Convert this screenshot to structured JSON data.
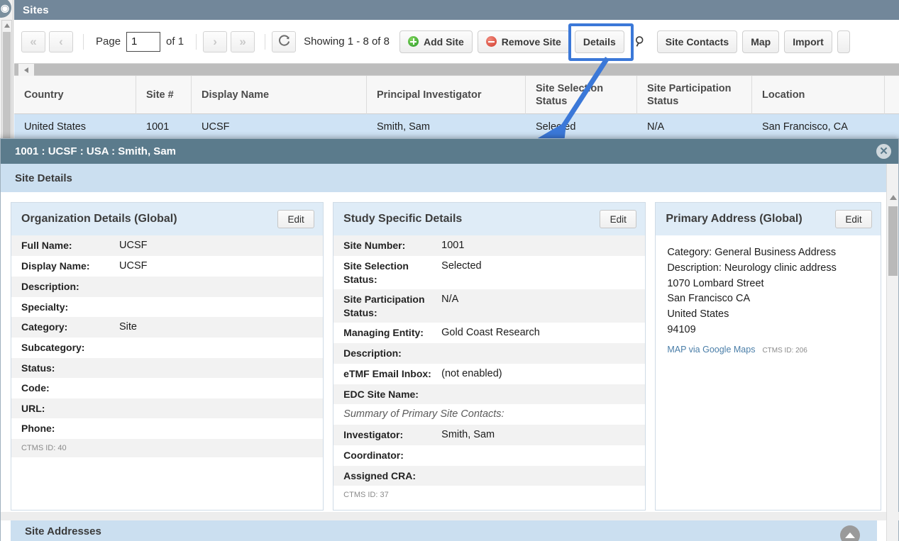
{
  "window": {
    "section_title": "Sites"
  },
  "toolbar": {
    "first_page_icon": "double-chevron-left-icon",
    "prev_page_icon": "chevron-left-icon",
    "page_label": "Page",
    "page_value": "1",
    "of_label": "of 1",
    "next_page_icon": "chevron-right-icon",
    "last_page_icon": "double-chevron-right-icon",
    "refresh_icon": "refresh-icon",
    "showing_text": "Showing 1 - 8 of 8",
    "add_site": "Add Site",
    "remove_site": "Remove Site",
    "details": "Details",
    "search_icon": "magnifier-icon",
    "site_contacts": "Site Contacts",
    "map": "Map",
    "import": "Import"
  },
  "grid": {
    "columns": [
      "Country",
      "Site #",
      "Display Name",
      "Principal Investigator",
      "Site Selection Status",
      "Site Participation Status",
      "Location"
    ],
    "rows": [
      [
        "United States",
        "1001",
        "UCSF",
        "Smith, Sam",
        "Selected",
        "N/A",
        "San Francisco, CA"
      ]
    ]
  },
  "dialog": {
    "title": "1001 : UCSF : USA : Smith, Sam",
    "close_icon": "close-icon",
    "section_header": "Site Details",
    "org_panel": {
      "title": "Organization Details (Global)",
      "edit_label": "Edit",
      "fields": [
        {
          "key": "Full Name:",
          "value": "UCSF"
        },
        {
          "key": "Display Name:",
          "value": "UCSF"
        },
        {
          "key": "Description:",
          "value": ""
        },
        {
          "key": "Specialty:",
          "value": ""
        },
        {
          "key": "Category:",
          "value": "Site"
        },
        {
          "key": "Subcategory:",
          "value": ""
        },
        {
          "key": "Status:",
          "value": ""
        },
        {
          "key": "Code:",
          "value": ""
        },
        {
          "key": "URL:",
          "value": ""
        },
        {
          "key": "Phone:",
          "value": ""
        }
      ],
      "ctms_id": "CTMS ID: 40"
    },
    "study_panel": {
      "title": "Study Specific Details",
      "edit_label": "Edit",
      "fields": [
        {
          "key": "Site Number:",
          "value": "1001"
        },
        {
          "key": "Site Selection Status:",
          "value": "Selected"
        },
        {
          "key": "Site Participation Status:",
          "value": "N/A"
        },
        {
          "key": "Managing Entity:",
          "value": "Gold Coast Research"
        },
        {
          "key": "Description:",
          "value": ""
        },
        {
          "key": "eTMF Email Inbox:",
          "value": "(not enabled)"
        },
        {
          "key": "EDC Site Name:",
          "value": ""
        }
      ],
      "subheading": "Summary of Primary Site Contacts:",
      "contact_fields": [
        {
          "key": "Investigator:",
          "value": "Smith, Sam"
        },
        {
          "key": "Coordinator:",
          "value": ""
        },
        {
          "key": "Assigned CRA:",
          "value": ""
        }
      ],
      "ctms_id": "CTMS ID: 37"
    },
    "address_panel": {
      "title": "Primary Address (Global)",
      "edit_label": "Edit",
      "lines": [
        "Category: General Business Address",
        "Description: Neurology clinic address",
        "1070 Lombard Street",
        "San Francisco CA",
        "United States",
        "94109"
      ],
      "map_link": "MAP via Google Maps",
      "ctms_id": "CTMS ID: 206"
    },
    "bottom_section": {
      "title": "Site Addresses",
      "collapse_icon": "chevron-up-icon"
    }
  },
  "annotation": {
    "highlight_color": "#3b78d8",
    "target": "Details"
  }
}
